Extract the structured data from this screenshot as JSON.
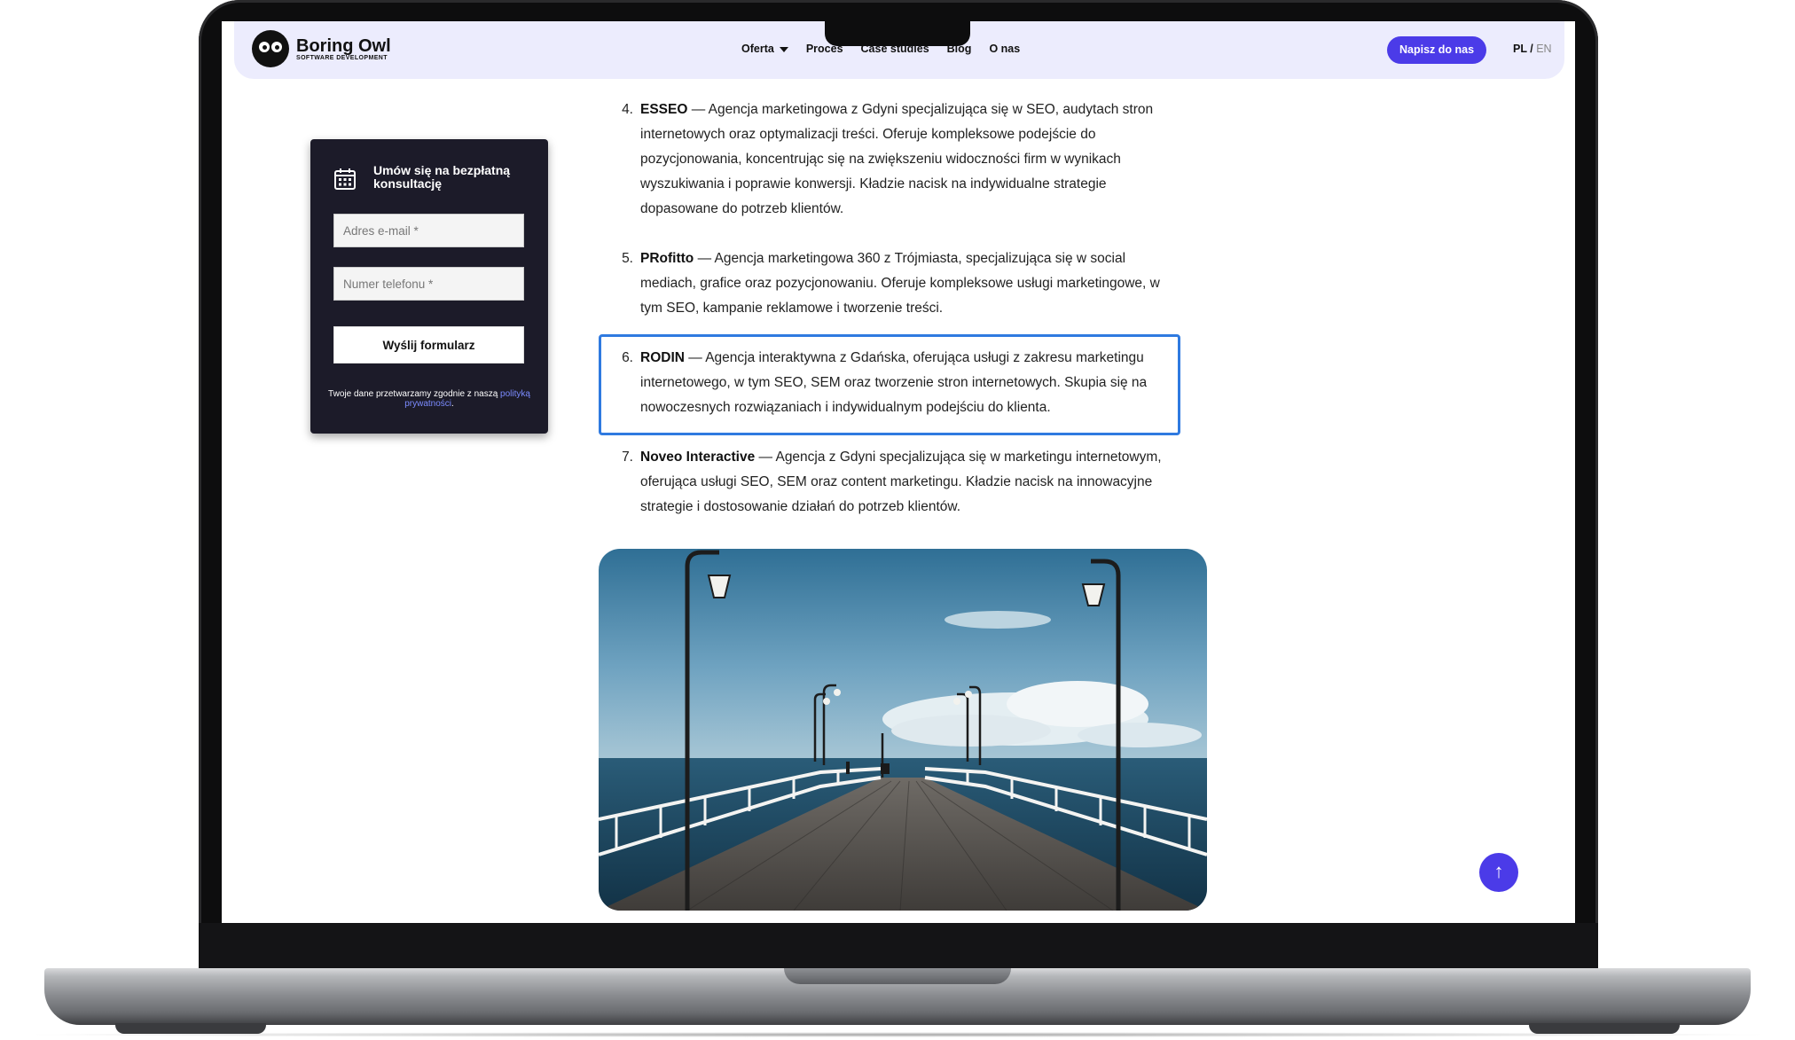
{
  "brand": {
    "name": "Boring Owl",
    "tagline": "SOFTWARE DEVELOPMENT"
  },
  "nav": {
    "items": [
      "Oferta",
      "Proces",
      "Case studies",
      "Blog",
      "O nas"
    ],
    "cta": "Napisz do nas",
    "lang_active": "PL",
    "lang_separator": "/",
    "lang_other": "EN"
  },
  "form": {
    "title": "Umów się na bezpłatną konsultację",
    "email_placeholder": "Adres e-mail *",
    "phone_placeholder": "Numer telefonu *",
    "submit": "Wyślij formularz",
    "privacy_text": "Twoje dane przetwarzamy zgodnie z naszą",
    "privacy_link": "polityką prywatności",
    "privacy_end": "."
  },
  "article": {
    "items": [
      {
        "num": "4.",
        "name": "ESSEO",
        "desc": " — Agencja marketingowa z Gdyni specjalizująca się w SEO, audytach stron internetowych oraz optymalizacji treści. Oferuje kompleksowe podejście do pozycjonowania, koncentrując się na zwiększeniu widoczności firm w wynikach wyszukiwania i poprawie konwersji. Kładzie nacisk na indywidualne strategie dopasowane do potrzeb klientów."
      },
      {
        "num": "5.",
        "name": "PRofitto",
        "desc": " — Agencja marketingowa 360 z Trójmiasta, specjalizująca się w social mediach, grafice oraz pozycjonowaniu. Oferuje kompleksowe usługi marketingowe, w tym SEO, kampanie reklamowe i tworzenie treści."
      },
      {
        "num": "6.",
        "name": "RODIN",
        "desc": " — Agencja interaktywna z Gdańska, oferująca usługi z zakresu marketingu internetowego, w tym SEO, SEM oraz tworzenie stron internetowych. Skupia się na nowoczesnych rozwiązaniach i indywidualnym podejściu do klienta."
      },
      {
        "num": "7.",
        "name": "Noveo Interactive",
        "desc": " — Agencja z Gdyni specjalizująca się w marketingu internetowym, oferująca usługi SEO, SEM oraz content marketingu. Kładzie nacisk na innowacyjne strategie i dostosowanie działań do potrzeb klientów."
      }
    ]
  },
  "scroll_top": "↑",
  "colors": {
    "accent": "#4b3be8",
    "nav_bg": "#ececfd",
    "form_bg": "#1c1b29",
    "highlight": "#2f7ae0"
  }
}
